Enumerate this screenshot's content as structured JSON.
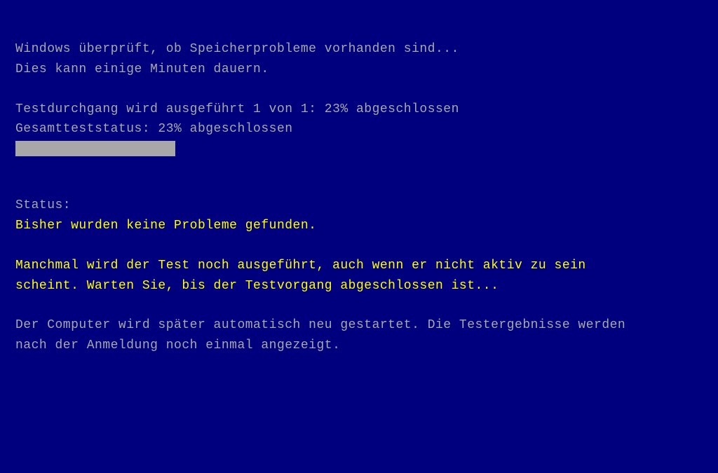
{
  "header": {
    "line1": "Windows überprüft, ob Speicherprobleme vorhanden sind...",
    "line2": "Dies kann einige Minuten dauern."
  },
  "test": {
    "run_status": "Testdurchgang wird ausgeführt  1 von  1: 23% abgeschlossen",
    "total_status": "Gesamtteststatus: 23% abgeschlossen",
    "progress_percent": 23
  },
  "status": {
    "label": "Status:",
    "no_problems": "Bisher wurden keine Probleme gefunden.",
    "wait_msg_line1": "Manchmal wird der Test noch ausgeführt, auch wenn er nicht aktiv zu sein",
    "wait_msg_line2": "scheint. Warten Sie, bis der Testvorgang abgeschlossen ist..."
  },
  "footer": {
    "line1": "Der Computer wird später automatisch neu gestartet. Die Testergebnisse werden",
    "line2": "nach der Anmeldung noch einmal angezeigt."
  }
}
